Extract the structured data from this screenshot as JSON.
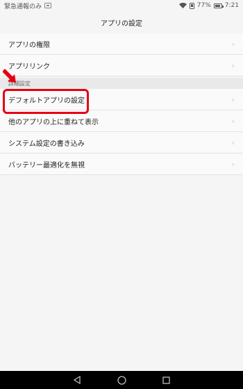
{
  "status_bar": {
    "carrier_text": "緊急通報のみ",
    "battery_percent": "77%",
    "time": "7:21",
    "battery_level": 0.77
  },
  "title": "アプリの設定",
  "section1": {
    "items": [
      {
        "label": "アプリの権限",
        "icon": "chevron-right-icon"
      },
      {
        "label": "アプリリンク",
        "icon": "chevron-right-icon"
      }
    ]
  },
  "section_header": "詳細設定",
  "section2": {
    "items": [
      {
        "label": "デフォルトアプリの設定",
        "icon": "chevron-right-icon"
      },
      {
        "label": "他のアプリの上に重ねて表示",
        "icon": "chevron-right-icon"
      },
      {
        "label": "システム設定の書き込み",
        "icon": "chevron-right-icon"
      },
      {
        "label": "バッテリー最適化を無視",
        "icon": "chevron-right-icon"
      }
    ]
  },
  "annotations": {
    "highlight_color": "#e60012",
    "arrow_color": "#e60012"
  },
  "nav": {
    "back_icon": "back-triangle-icon",
    "home_icon": "home-circle-icon",
    "recents_icon": "recents-square-icon"
  }
}
